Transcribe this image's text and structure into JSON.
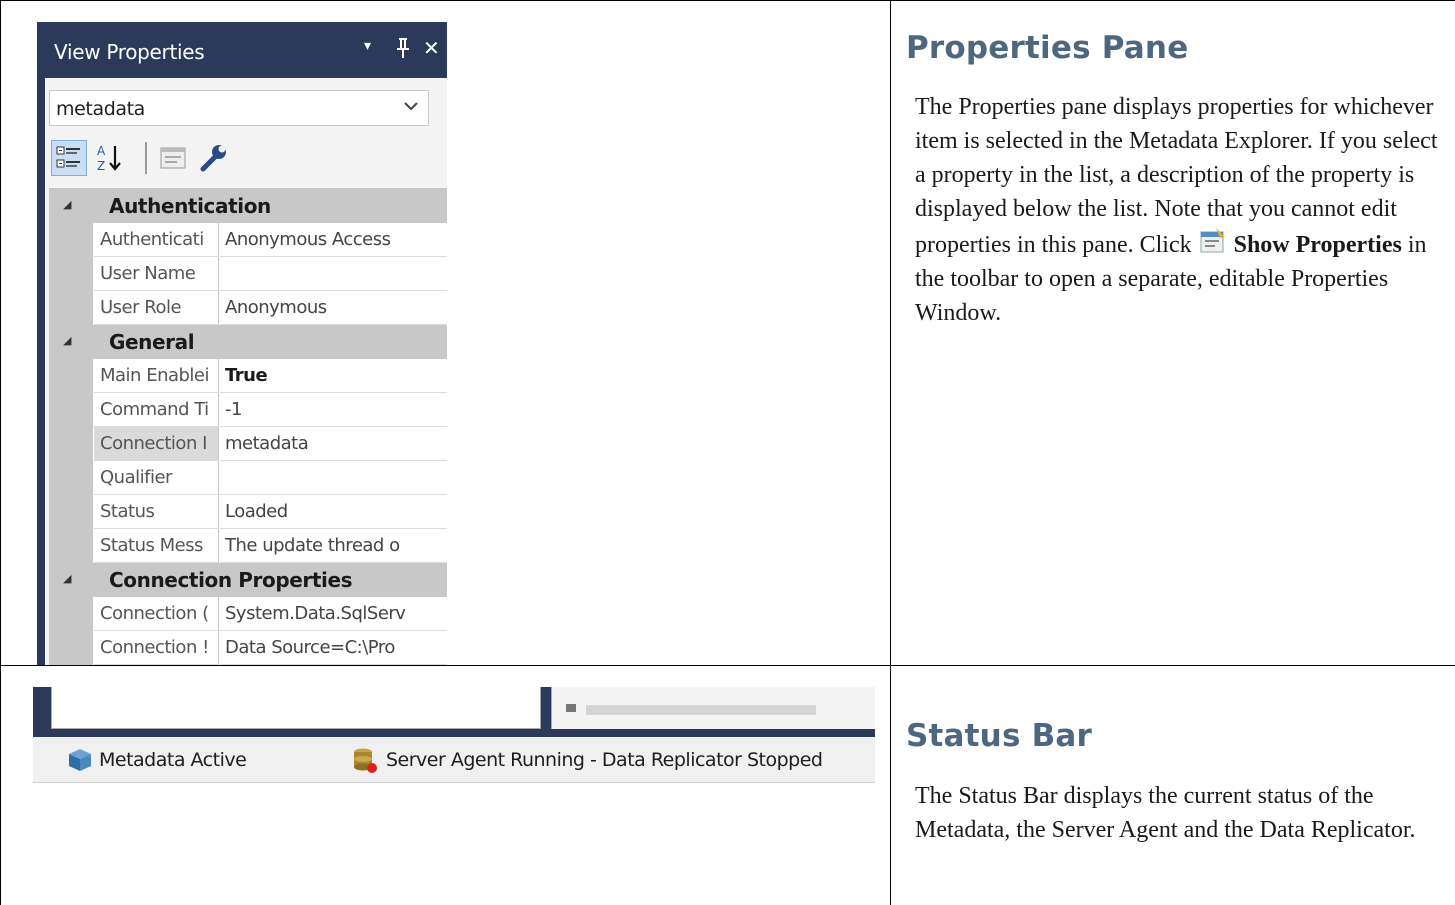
{
  "properties_panel": {
    "title": "View Properties",
    "title_controls": {
      "dropdown": "▾",
      "pin": "ᵽ",
      "close": "✕"
    },
    "selected_object": "metadata",
    "toolbar": [
      "categorized-view-icon",
      "alphabetical-sort-icon",
      "property-pages-icon",
      "wrench-icon"
    ],
    "categories": [
      {
        "name": "Authentication",
        "properties": [
          {
            "name": "Authenticati",
            "value": "Anonymous Access"
          },
          {
            "name": "User Name",
            "value": ""
          },
          {
            "name": "User Role",
            "value": "Anonymous"
          }
        ]
      },
      {
        "name": "General",
        "properties": [
          {
            "name": "Main Enablei",
            "value": "True"
          },
          {
            "name": "Command Ti",
            "value": "-1"
          },
          {
            "name": "Connection I",
            "value": "metadata"
          },
          {
            "name": "Qualifier",
            "value": ""
          },
          {
            "name": "Status",
            "value": "Loaded"
          },
          {
            "name": "Status Mess",
            "value": "The update thread o"
          }
        ]
      },
      {
        "name": "Connection Properties",
        "properties": [
          {
            "name": "Connection (",
            "value": "System.Data.SqlServ"
          },
          {
            "name": "Connection !",
            "value": "Data Source=C:\\Pro"
          }
        ]
      }
    ]
  },
  "status_bar_shot": {
    "metadata_status": "Metadata Active",
    "agent_status": "Server Agent Running - Data Replicator Stopped"
  },
  "sections": {
    "properties": {
      "heading": "Properties Pane",
      "text_1": "The Properties pane displays properties for whichever item is selected in the Metadata Explorer. If you select a property in the list, a description of the property is displayed below the list. Note that you cannot edit properties in this pane. Click",
      "link_label": "Show Properties",
      "text_2": "in the toolbar to open a separate, editable Properties Window."
    },
    "status_bar": {
      "heading": "Status Bar",
      "text": "The Status Bar displays the current status of the Metadata, the Server Agent and the Data Replicator."
    }
  },
  "colors": {
    "panel_dark": "#2b3a5a",
    "heading": "#4d6780",
    "category_bg": "#c8c8c8"
  }
}
